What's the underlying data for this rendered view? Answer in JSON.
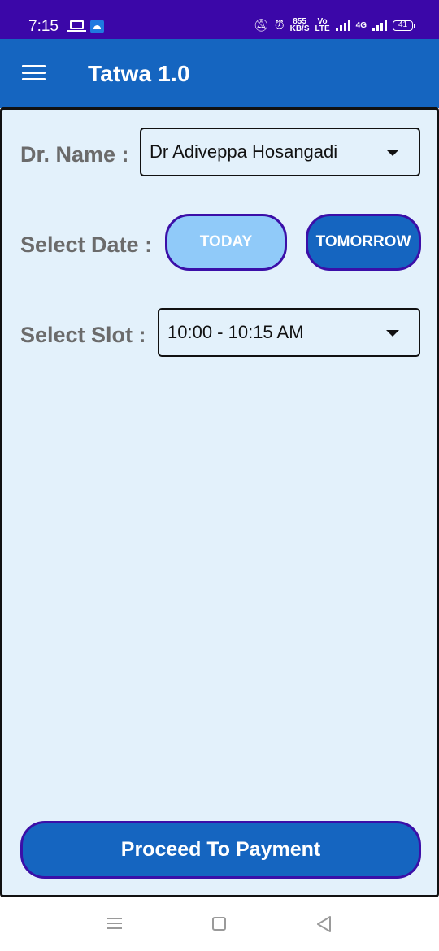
{
  "status_bar": {
    "time": "7:15",
    "net_speed_value": "855",
    "net_speed_unit": "KB/S",
    "volte_top": "Vo",
    "volte_bottom": "LTE",
    "network_label": "4G",
    "battery": "41"
  },
  "app_bar": {
    "title": "Tatwa 1.0"
  },
  "form": {
    "doctor_label": "Dr. Name :",
    "doctor_value": "Dr Adiveppa Hosangadi",
    "date_label": "Select Date :",
    "today_label": "TODAY",
    "tomorrow_label": "TOMORROW",
    "slot_label": "Select Slot :",
    "slot_value": "10:00 - 10:15 AM"
  },
  "actions": {
    "proceed_label": "Proceed To Payment"
  },
  "colors": {
    "status_bar": "#3b07a8",
    "app_bar": "#1565c0",
    "content_bg": "#e3f1fb",
    "today_button": "#90caf9",
    "tomorrow_button": "#1565c0",
    "button_border": "#3b0fa8"
  },
  "icons": {
    "menu": "hamburger-icon",
    "dropdown": "caret-down-icon",
    "nav_menu": "recent-apps-icon",
    "nav_home": "home-icon",
    "nav_back": "back-icon"
  }
}
